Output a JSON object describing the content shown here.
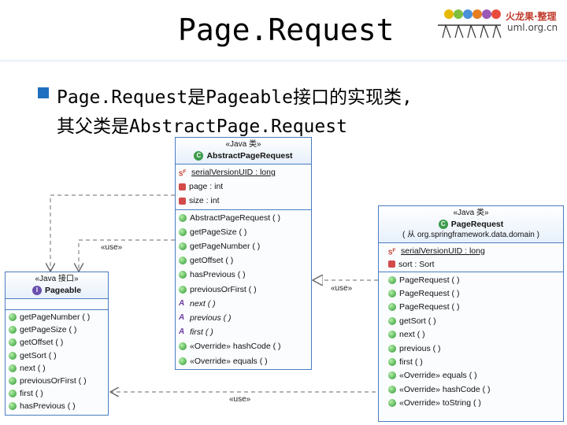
{
  "slide": {
    "title": "Page.Request",
    "bullet_line1": "Page.Request是Pageable接口的实现类,",
    "bullet_line2": "其父类是AbstractPage.Request"
  },
  "logo": {
    "text_cn": "火龙果·整理",
    "text_url": "uml.org.cn"
  },
  "colors": {
    "border": "#4a7dc0",
    "bullet": "#1f6fbf",
    "method_icon": "#2f9c3a",
    "field_icon": "#d24a4a"
  },
  "abstract_page_request": {
    "stereotype": "«Java 类»",
    "name": "AbstractPageRequest",
    "fields": [
      "serialVersionUID : long",
      "page : int",
      "size : int"
    ],
    "methods": [
      "AbstractPageRequest ( )",
      "getPageSize ( )",
      "getPageNumber ( )",
      "getOffset ( )",
      "hasPrevious ( )",
      "previousOrFirst ( )",
      "next ( )",
      "previous ( )",
      "first ( )",
      "«Override» hashCode ( )",
      "«Override» equals ( )"
    ]
  },
  "pageable": {
    "stereotype": "«Java 接口»",
    "name": "Pageable",
    "methods": [
      "getPageNumber ( )",
      "getPageSize ( )",
      "getOffset ( )",
      "getSort ( )",
      "next ( )",
      "previousOrFirst ( )",
      "first ( )",
      "hasPrevious ( )"
    ]
  },
  "page_request": {
    "stereotype": "«Java 类»",
    "name": "PageRequest",
    "package": "( 从 org.springframework.data.domain )",
    "fields": [
      "serialVersionUID : long",
      "sort : Sort"
    ],
    "methods": [
      "PageRequest ( )",
      "PageRequest ( )",
      "PageRequest ( )",
      "getSort ( )",
      "next ( )",
      "previous ( )",
      "first ( )",
      "«Override» equals ( )",
      "«Override» hashCode ( )",
      "«Override» toString ( )"
    ]
  },
  "connectors": {
    "use1": "«use»",
    "use2": "«use»",
    "use3": "«use»"
  }
}
